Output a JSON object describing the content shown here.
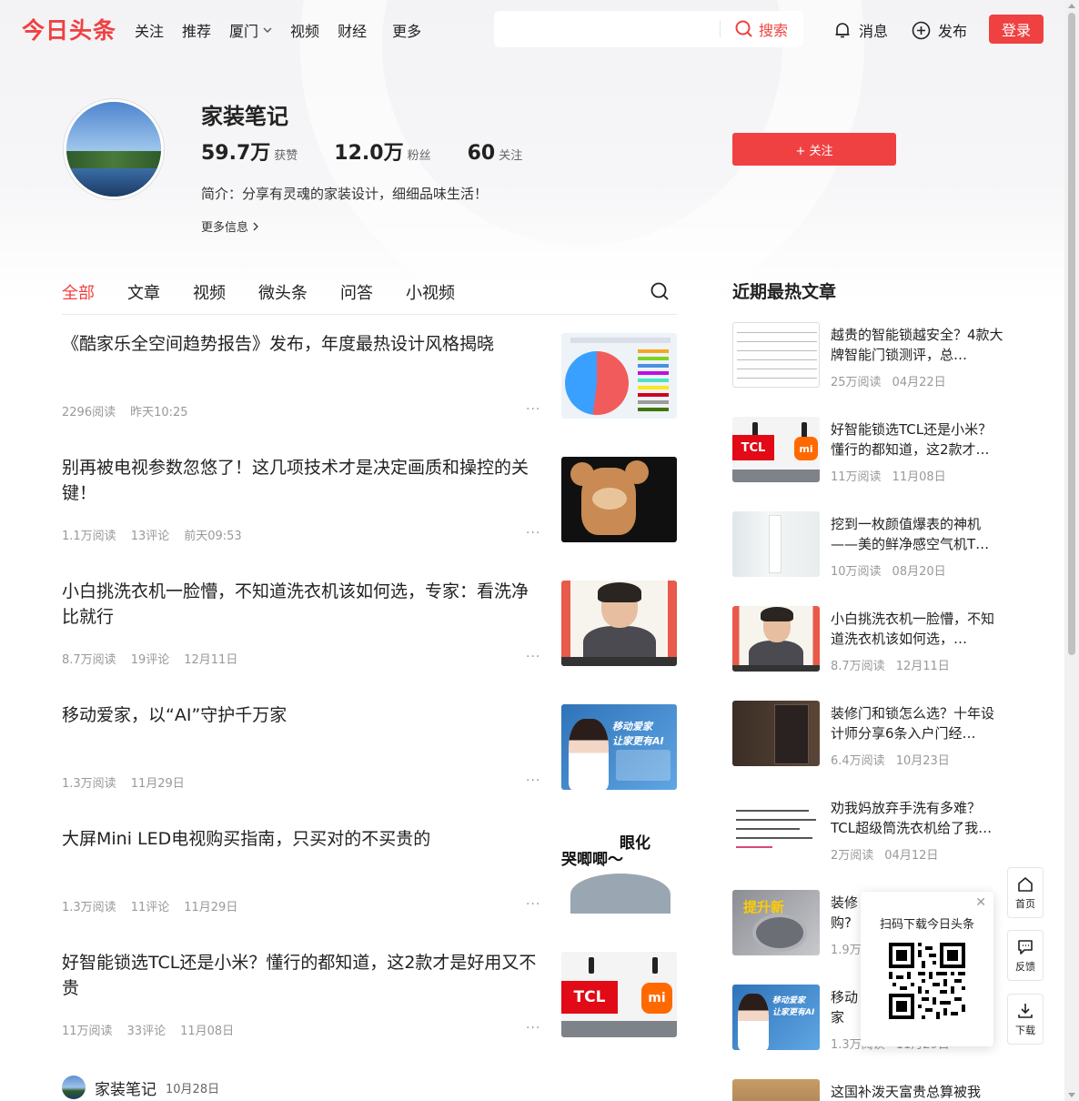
{
  "nav": {
    "logo": "今日头条",
    "links": [
      "关注",
      "推荐",
      "厦门",
      "视频",
      "财经"
    ],
    "more": "更多",
    "search_placeholder": "",
    "search_button": "搜索",
    "messages": "消息",
    "publish": "发布",
    "login": "登录"
  },
  "profile": {
    "name": "家装笔记",
    "likes": {
      "num": "59.7万",
      "label": "获赞"
    },
    "fans": {
      "num": "12.0万",
      "label": "粉丝"
    },
    "following": {
      "num": "60",
      "label": "关注"
    },
    "bio": "简介：分享有灵魂的家装设计，细细品味生活！",
    "more_info": "更多信息",
    "follow_button": "+ 关注"
  },
  "tabs": [
    "全部",
    "文章",
    "视频",
    "微头条",
    "问答",
    "小视频"
  ],
  "feed": [
    {
      "title": "《酷家乐全空间趋势报告》发布，年度最热设计风格揭晓",
      "reads": "2296阅读",
      "comments": "",
      "time": "昨天10:25"
    },
    {
      "title": "别再被电视参数忽悠了！这几项技术才是决定画质和操控的关键！",
      "reads": "1.1万阅读",
      "comments": "13评论",
      "time": "前天09:53"
    },
    {
      "title": "小白挑洗衣机一脸懵，不知道洗衣机该如何选，专家：看洗净比就行",
      "reads": "8.7万阅读",
      "comments": "19评论",
      "time": "12月11日"
    },
    {
      "title": "移动爱家，以“AI”守护千万家",
      "reads": "1.3万阅读",
      "comments": "",
      "time": "11月29日"
    },
    {
      "title": "大屏Mini LED电视购买指南，只买对的不买贵的",
      "reads": "1.3万阅读",
      "comments": "11评论",
      "time": "11月29日"
    },
    {
      "title": "好智能锁选TCL还是小米？懂行的都知道，这2款才是好用又不贵",
      "reads": "11万阅读",
      "comments": "33评论",
      "time": "11月08日"
    }
  ],
  "thumb_text": {
    "ai_line1": "移动爱家",
    "ai_line2": "让家更有AI",
    "cartoon_line1": "眼化",
    "cartoon_line2": "哭唧唧～",
    "tcl": "TCL",
    "mi": "mi",
    "wash": "提升新"
  },
  "author_row": {
    "name": "家装笔记",
    "date": "10月28日"
  },
  "sidebar": {
    "title": "近期最热文章",
    "items": [
      {
        "title": "越贵的智能锁越安全？4款大牌智能门锁测评，总…",
        "reads": "25万阅读",
        "date": "04月22日"
      },
      {
        "title": "好智能锁选TCL还是小米？懂行的都知道，这2款才…",
        "reads": "11万阅读",
        "date": "11月08日"
      },
      {
        "title": "挖到一枚颜值爆表的神机——美的鲜净感空气机T…",
        "reads": "10万阅读",
        "date": "08月20日"
      },
      {
        "title": "小白挑洗衣机一脸懵，不知道洗衣机该如何选，…",
        "reads": "8.7万阅读",
        "date": "12月11日"
      },
      {
        "title": "装修门和锁怎么选？十年设计师分享6条入户门经…",
        "reads": "6.4万阅读",
        "date": "10月23日"
      },
      {
        "title": "劝我妈放弃手洗有多难？TCL超级筒洗衣机给了我…",
        "reads": "2万阅读",
        "date": "04月12日"
      },
      {
        "title": "装修",
        "title_tail": "购?",
        "reads": "1.9万",
        "date": ""
      },
      {
        "title": "移动",
        "title_tail": "家",
        "reads": "1.3万阅读",
        "date": "11月29日"
      },
      {
        "title": "这国补泼天富贵总算被我",
        "reads": "",
        "date": ""
      }
    ]
  },
  "qr_popup": {
    "text": "扫码下载今日头条"
  },
  "float_buttons": [
    {
      "label": "首页",
      "icon": "home-icon"
    },
    {
      "label": "反馈",
      "icon": "feedback-icon"
    },
    {
      "label": "下载",
      "icon": "download-icon"
    }
  ],
  "colors": {
    "brand_red": "#f04142",
    "meta_gray": "#999999"
  }
}
